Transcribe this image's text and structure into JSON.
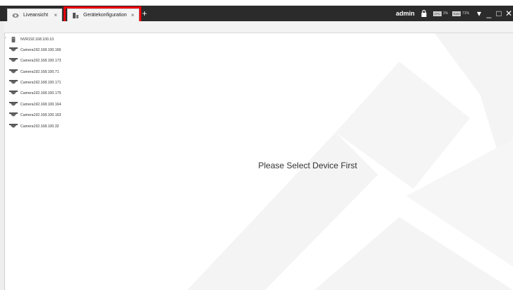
{
  "tabs": [
    {
      "label": "Liveansicht",
      "close": "×",
      "icon": "eye-icon"
    },
    {
      "label": "Gerätekonfiguration",
      "close": "×",
      "icon": "device-config-icon"
    }
  ],
  "add_tab_label": "+",
  "user": {
    "name": "admin",
    "lock_icon": "lock-icon"
  },
  "meters": [
    {
      "tag": "CPU",
      "value": "1%"
    },
    {
      "tag": "RAM",
      "value": "71%"
    }
  ],
  "window_controls": {
    "menu": "▾",
    "minimize": "_",
    "maximize": "□",
    "close": "✕"
  },
  "device_tree": [
    {
      "label": "NVR192.168.100.10",
      "type": "nvr"
    },
    {
      "label": "Camera192.168.100.166",
      "type": "camera"
    },
    {
      "label": "Camera192.168.100.173",
      "type": "camera"
    },
    {
      "label": "Camera192.168.100.71",
      "type": "camera"
    },
    {
      "label": "Camera192.168.100.171",
      "type": "camera"
    },
    {
      "label": "Camera192.168.100.175",
      "type": "camera"
    },
    {
      "label": "Camera192.168.100.164",
      "type": "camera"
    },
    {
      "label": "Camera192.168.100.163",
      "type": "camera"
    },
    {
      "label": "Camera192.168.100.32",
      "type": "camera"
    }
  ],
  "main": {
    "message": "Please Select Device First"
  },
  "colors": {
    "highlight": "#e8000b",
    "titlebar": "#2b2b2b",
    "watermark": "#f2f2f2"
  }
}
